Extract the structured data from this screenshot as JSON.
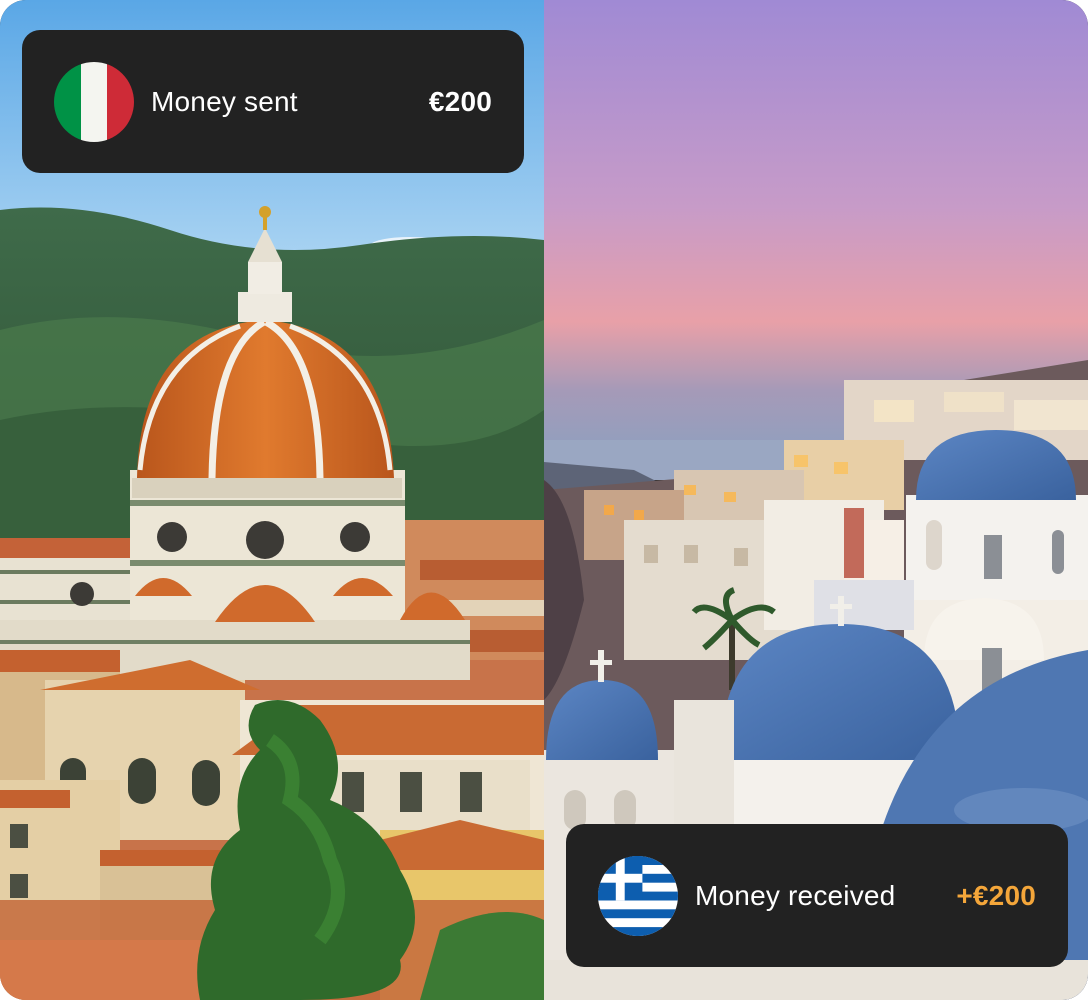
{
  "sent_card": {
    "label": "Money sent",
    "amount": "€200",
    "flag_icon": "italy-flag-icon",
    "amount_color": "#ffffff"
  },
  "received_card": {
    "label": "Money received",
    "amount": "+€200",
    "flag_icon": "greece-flag-icon",
    "amount_color": "#f4a63a"
  },
  "colors": {
    "card_background": "#222222",
    "card_text": "#ffffff"
  }
}
